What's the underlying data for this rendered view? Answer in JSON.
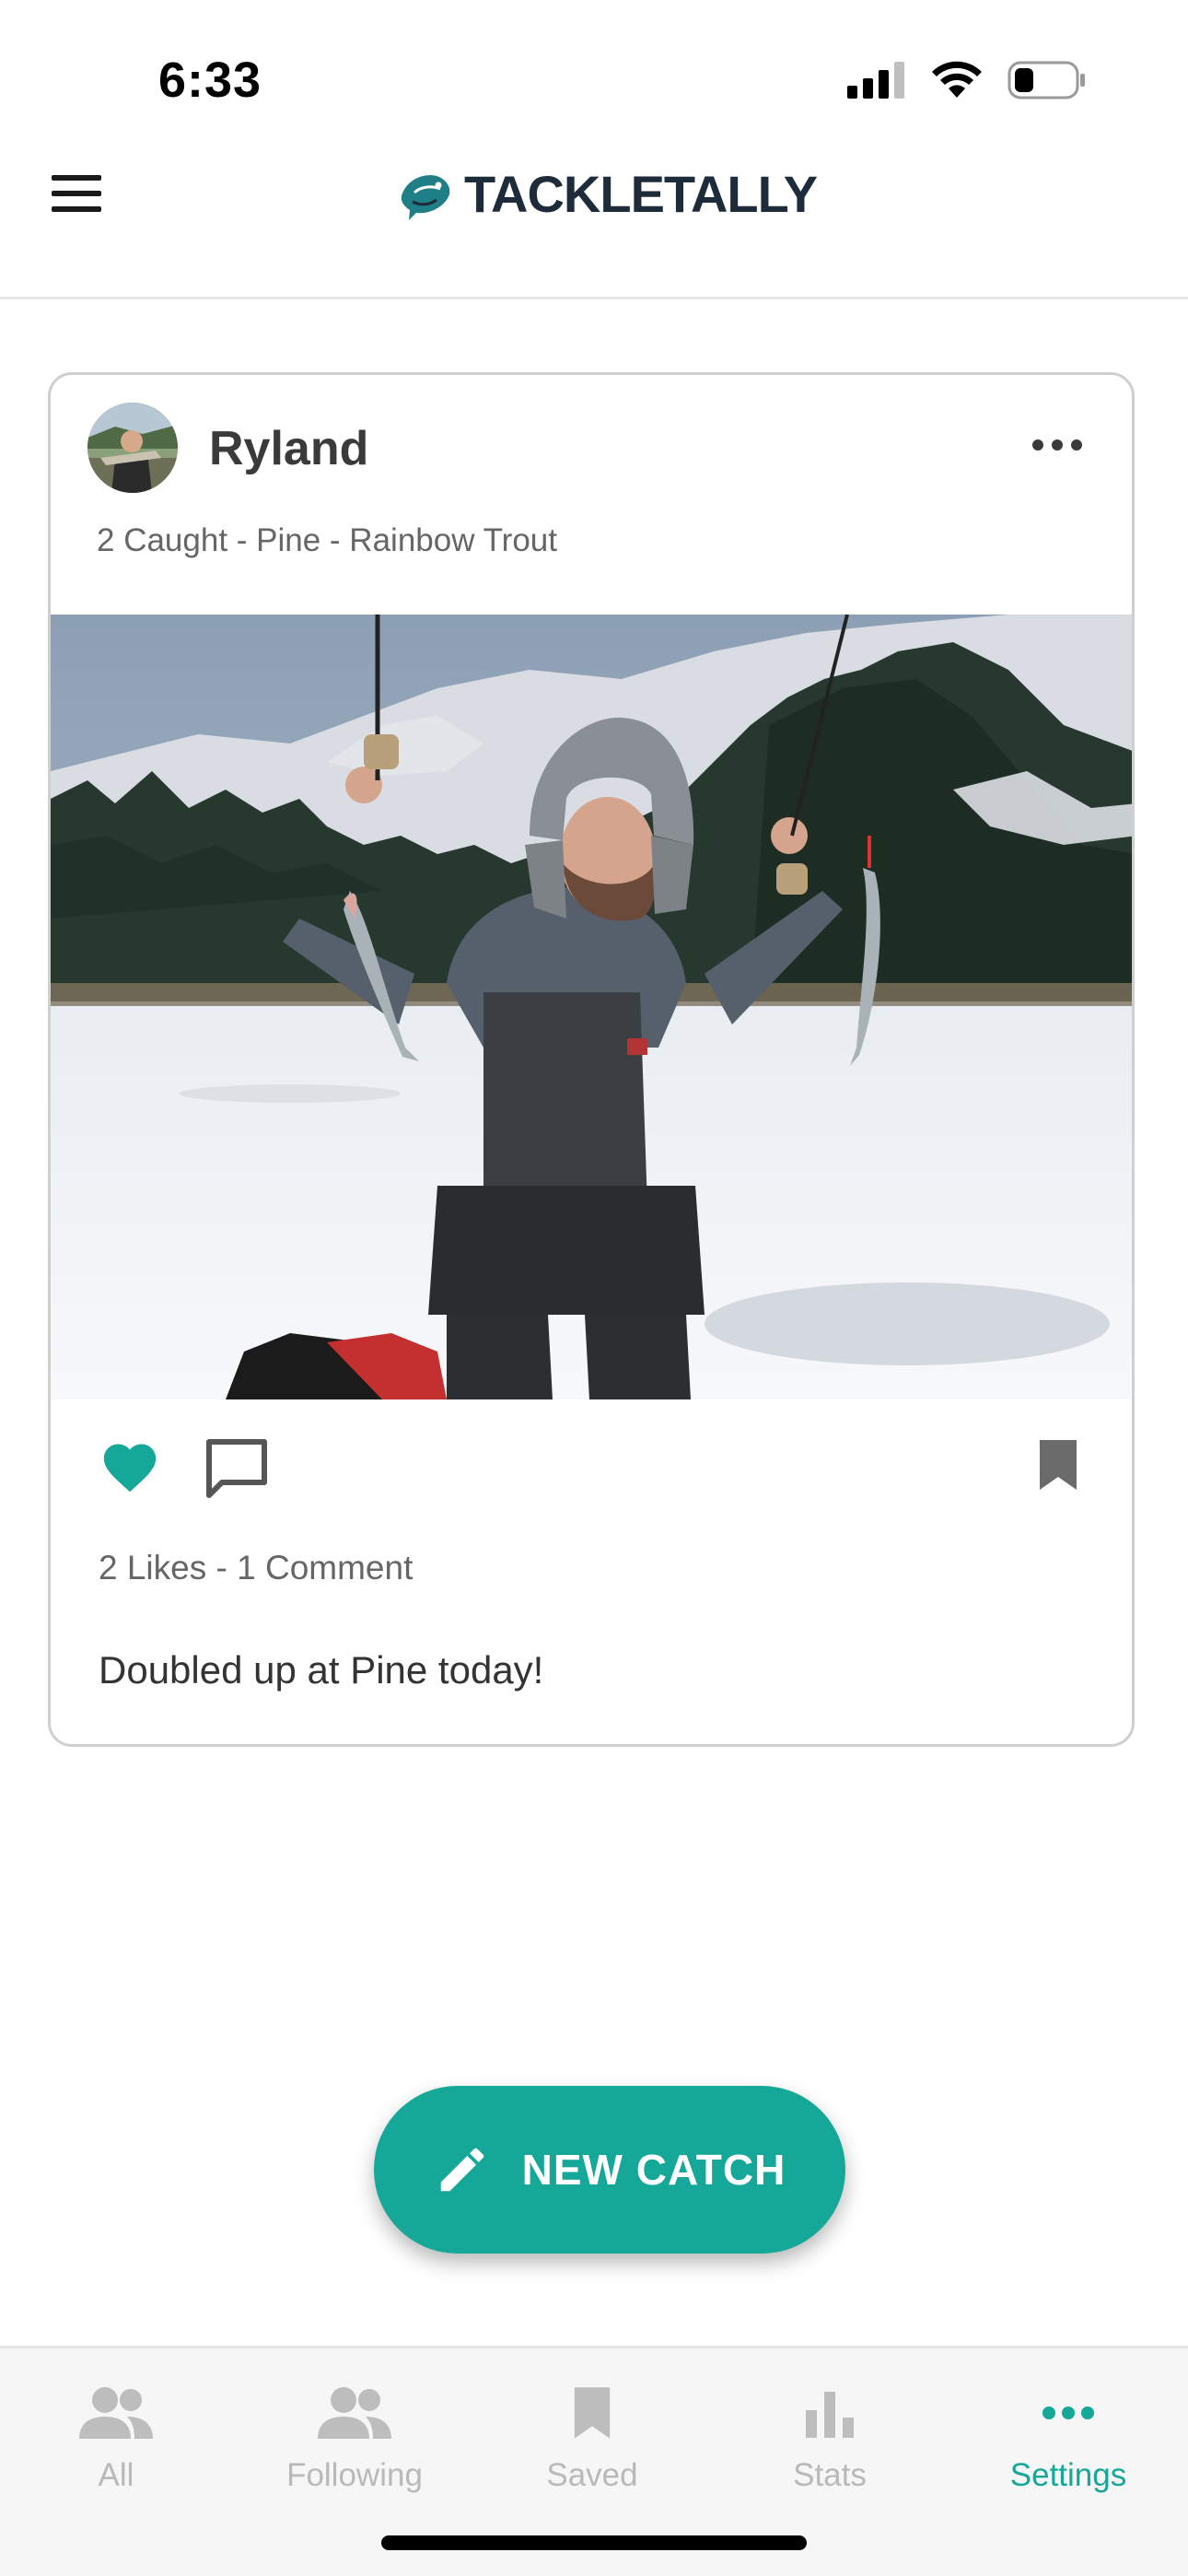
{
  "status_bar": {
    "time": "6:33"
  },
  "header": {
    "logo_text": "TACKLETALLY"
  },
  "post": {
    "author": "Ryland",
    "meta": "2 Caught - Pine - Rainbow Trout",
    "stats": "2 Likes - 1 Comment",
    "caption": "Doubled up at Pine today!",
    "liked": true
  },
  "fab": {
    "label": "NEW CATCH"
  },
  "nav": {
    "items": [
      {
        "label": "All",
        "icon": "people-icon"
      },
      {
        "label": "Following",
        "icon": "people-icon"
      },
      {
        "label": "Saved",
        "icon": "bookmark-icon"
      },
      {
        "label": "Stats",
        "icon": "bar-chart-icon"
      },
      {
        "label": "Settings",
        "icon": "more-horizontal-icon"
      }
    ],
    "active": "Settings"
  },
  "colors": {
    "accent": "#15a899",
    "inactive": "#b9b9b9",
    "logo_dark": "#1d2b3a"
  }
}
